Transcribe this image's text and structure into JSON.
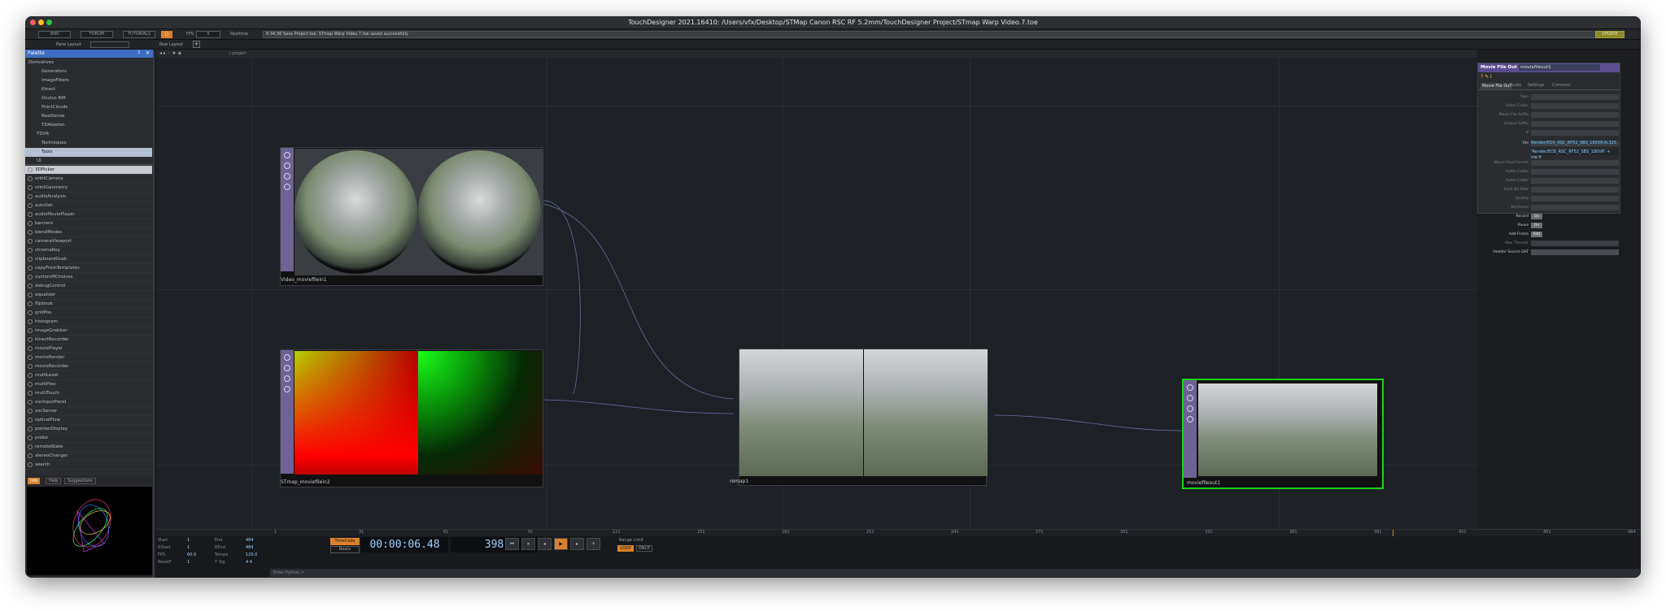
{
  "window": {
    "title": "TouchDesigner 2021.16410: /Users/vfx/Desktop/STMap Canon RSC RF 5.2mm/TouchDesigner Project/STmap Warp Video.7.toe"
  },
  "toolbar": {
    "buttons": [
      "WIKI",
      "FORUM",
      "TUTORIALS"
    ],
    "fps_label": "FPS",
    "fps_value": "5",
    "realtime_label": "Realtime",
    "status_message": "6:34:36 Save Project  toe: STmap Warp Video.7.toe saved successfully",
    "update_label": "UPDATE"
  },
  "toolbar2": {
    "layout_a": "Pane Layout",
    "layout_b": "Row Layout",
    "path": "/ project"
  },
  "palette": {
    "title": "Palette",
    "tree": [
      "Derivatives",
      "Generators",
      "ImageFilters",
      "Kinect",
      "Oculus Rift",
      "PointClouds",
      "RealSense",
      "TDAbleton",
      "TDVR",
      "Techniques",
      "Tools",
      "UI"
    ],
    "selected_tree_item": "Tools",
    "items": [
      "3DPicker",
      "orbitCamera",
      "orbitGeometry",
      "audioAnalysis",
      "autoSet",
      "audioMoviePlayer",
      "banners",
      "blendModes",
      "cameraViewport",
      "chromaKey",
      "clipboardGrab",
      "copyFromTemplates",
      "customMChoices",
      "debugControl",
      "equalizer",
      "flipbook",
      "gridPos",
      "histogram",
      "imageGrabber",
      "kinectRecorder",
      "moviePlayer",
      "movieRender",
      "movieRecorder",
      "multiLevel",
      "multiPlex",
      "multiTouch",
      "oscInputPanel",
      "oscServer",
      "opticalFlow",
      "pointerDisplay",
      "probe",
      "remoteState",
      "stereoChanger",
      "search"
    ],
    "selected_item": "3DPicker",
    "preview_tabs": [
      "Info",
      "Help",
      "Suggestions"
    ]
  },
  "nodes": {
    "top1": "Video_moviefilein1",
    "top2": "STmap_moviefilein2",
    "top3": "remap1",
    "top4": "moviefileout1"
  },
  "params": {
    "op_type": "Movie File Out",
    "op_name": "moviefileout1",
    "tabs": [
      "Movie File Out",
      "Audio",
      "Settings",
      "Common"
    ],
    "rows": [
      "Type",
      "Video Codec",
      "Movie File Suffix",
      "Unique Suffix",
      "N"
    ],
    "file_label": "File",
    "file_value": "Render/EOS_RSC_RF52_SBS_180VR.N.325",
    "file_expr": "'Render/EOS_RSC_RF52_SBS_180VR' + me.fi",
    "lower_rows": [
      "Movie Pixel Format",
      "Audio Codec",
      "Audio Codec",
      "Limit Bit Rate",
      "Quality",
      "Keyframe"
    ],
    "record_label": "Record",
    "record_value": "On",
    "pause_label": "Pause",
    "pause_value": "On",
    "addframe_label": "Add Frame",
    "addframe_value": "Add",
    "maxthreads_label": "Max Threads",
    "header_dat_label": "Header Source DAT"
  },
  "timeline": {
    "stats": [
      [
        "Start",
        "1",
        "End",
        "484"
      ],
      [
        "RStart",
        "1",
        "REnd",
        "484"
      ],
      [
        "FPS",
        "60.0",
        "Tempo",
        "120.0"
      ],
      [
        "ResetF",
        "1",
        "T Sig",
        "4   4"
      ]
    ],
    "timecode_label": "TimeCode",
    "beats_label": "Beats",
    "timecode": "00:00:06.48",
    "frame": "398",
    "range_label": "Range Limit",
    "loop_label": "LOOP",
    "once_label": "ONCE",
    "ticks": [
      "1",
      "31",
      "61",
      "91",
      "121",
      "151",
      "181",
      "211",
      "241",
      "271",
      "301",
      "331",
      "361",
      "391",
      "421",
      "451",
      "484"
    ],
    "python_hint": "Enter Python >"
  },
  "colors": {
    "accent": "#d9822b",
    "selected_node": "#18d418",
    "operator": "#6e6394",
    "link": "#6670a0"
  }
}
